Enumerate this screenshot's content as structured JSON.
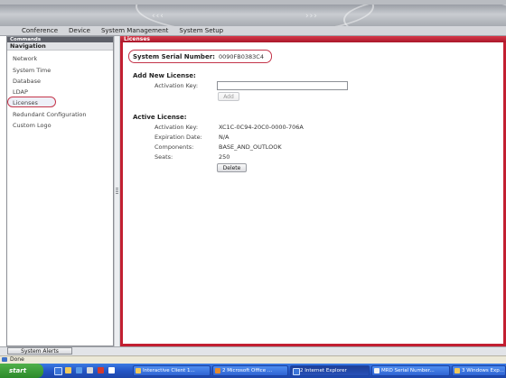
{
  "menubar": {
    "items": [
      "Conference",
      "Device",
      "System Management",
      "System Setup"
    ]
  },
  "sidebar": {
    "commands_header": "Commands",
    "navigation_header": "Navigation",
    "items": [
      {
        "label": "Network"
      },
      {
        "label": "System Time"
      },
      {
        "label": "Database"
      },
      {
        "label": "LDAP"
      },
      {
        "label": "Licenses",
        "selected": true
      },
      {
        "label": "Redundant Configuration"
      },
      {
        "label": "Custom Logo"
      }
    ]
  },
  "content": {
    "header": "Licenses",
    "serial_label": "System Serial Number:",
    "serial_value": "0090FB0383C4",
    "add_section_title": "Add New License:",
    "activation_key_label": "Activation Key:",
    "activation_key_value": "",
    "add_button": "Add",
    "active_section_title": "Active License:",
    "active_license": {
      "activation_key_label": "Activation Key:",
      "activation_key": "XC1C-0C94-20C0-0000-706A",
      "expiration_label": "Expiration Date:",
      "expiration": "N/A",
      "components_label": "Components:",
      "components": "BASE_AND_OUTLOOK",
      "seats_label": "Seats:",
      "seats": "250"
    },
    "delete_button": "Delete"
  },
  "alerts": {
    "tab_label": "System Alerts"
  },
  "statusbar": {
    "text": "Done"
  },
  "taskbar": {
    "start_label": "start",
    "tasks": [
      {
        "label": "Interactive Client 1...",
        "active": false
      },
      {
        "label": "2 Microsoft Office ...",
        "active": false
      },
      {
        "label": "2 Internet Explorer",
        "active": true
      },
      {
        "label": "MRD Serial Number...",
        "active": false
      },
      {
        "label": "3 Windows Exp...",
        "active": false
      }
    ]
  },
  "colors": {
    "accent": "#c21f31",
    "selection_ring": "#c4354a",
    "taskbar": "#2456c6",
    "start_button": "#3a9a36"
  }
}
